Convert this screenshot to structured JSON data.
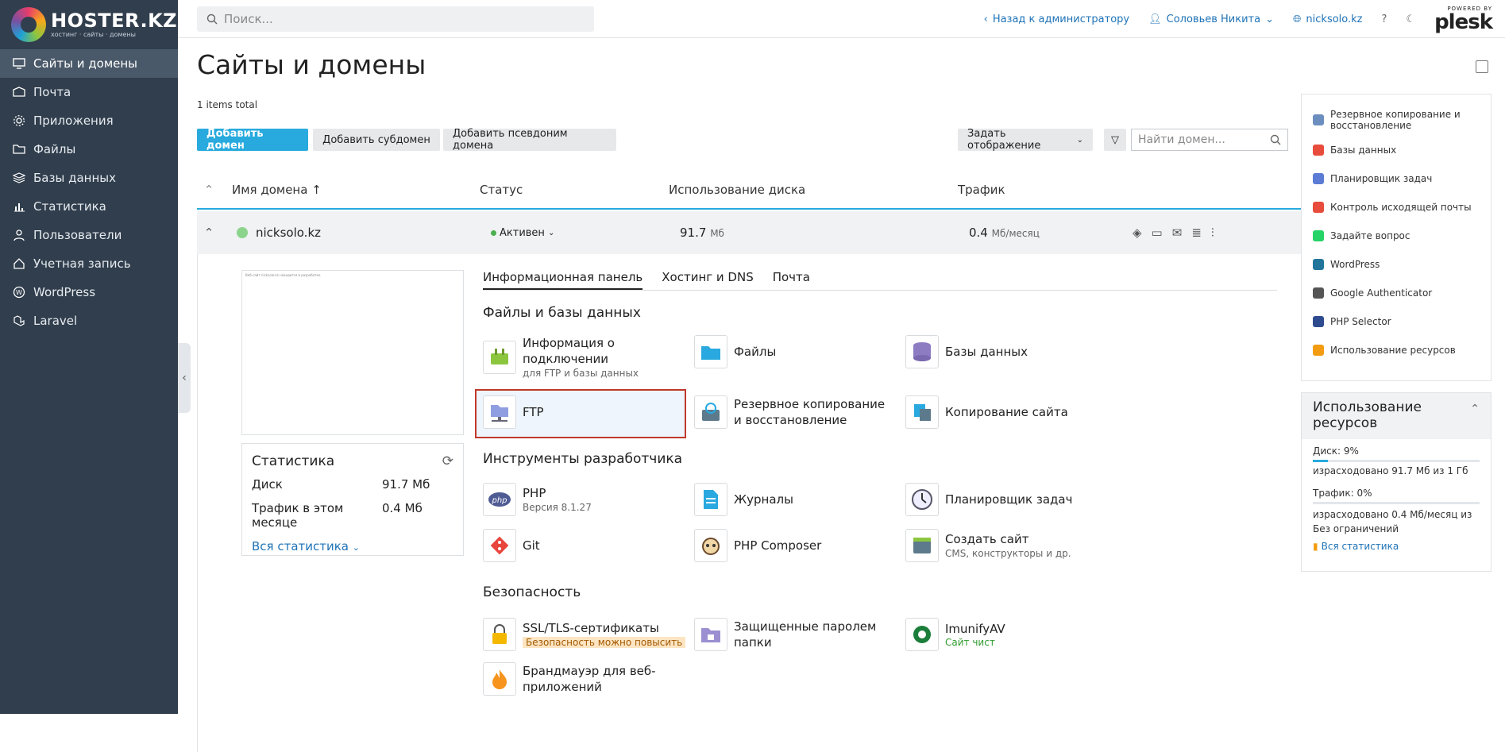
{
  "brand": {
    "name": "HOSTER.KZ",
    "tagline": "хостинг · сайты · домены"
  },
  "sidebar": {
    "items": [
      {
        "label": "Сайты и домены",
        "icon": "monitor-icon",
        "active": true
      },
      {
        "label": "Почта",
        "icon": "mail-icon"
      },
      {
        "label": "Приложения",
        "icon": "gear-icon"
      },
      {
        "label": "Файлы",
        "icon": "folder-icon"
      },
      {
        "label": "Базы данных",
        "icon": "layers-icon"
      },
      {
        "label": "Статистика",
        "icon": "bar-chart-icon"
      },
      {
        "label": "Пользователи",
        "icon": "user-icon"
      },
      {
        "label": "Учетная запись",
        "icon": "account-icon"
      },
      {
        "label": "WordPress",
        "icon": "wordpress-icon"
      },
      {
        "label": "Laravel",
        "icon": "laravel-icon"
      }
    ]
  },
  "topbar": {
    "search_placeholder": "Поиск...",
    "back_admin": "Назад к администратору",
    "user": "Соловьев Никита",
    "domain": "nicksolo.kz",
    "powered_by": "POWERED BY",
    "plesk": "plesk"
  },
  "page": {
    "title": "Сайты и домены",
    "items_total": "1 items total",
    "add_domain": "Добавить домен",
    "add_subdomain": "Добавить субдомен",
    "add_alias": "Добавить псевдоним домена",
    "set_view": "Задать отображение",
    "find_placeholder": "Найти домен..."
  },
  "table": {
    "columns": [
      "Имя домена ↑",
      "Статус",
      "Использование диска",
      "Трафик"
    ],
    "row": {
      "domain": "nicksolo.kz",
      "status": "Активен",
      "disk": "91.7",
      "disk_unit": "Мб",
      "traffic": "0.4",
      "traffic_unit": "Мб/месяц"
    }
  },
  "detail": {
    "thumb_text": "Веб-сайт nicksolo.kz находится в разработке",
    "stats": {
      "title": "Статистика",
      "disk_label": "Диск",
      "disk_value": "91.7 Мб",
      "traffic_label": "Трафик в этом месяце",
      "traffic_value": "0.4 Мб",
      "all_link": "Вся статистика"
    },
    "tabs": [
      "Информационная панель",
      "Хостинг и DNS",
      "Почта"
    ],
    "sections": {
      "files": "Файлы и базы данных",
      "dev": "Инструменты разработчика",
      "security": "Безопасность"
    },
    "tools": {
      "connection": {
        "label": "Информация о подключении",
        "sub": "для FTP и базы данных"
      },
      "files": {
        "label": "Файлы"
      },
      "databases": {
        "label": "Базы данных"
      },
      "ftp": {
        "label": "FTP"
      },
      "backup": {
        "label": "Резервное копирование и восстановление"
      },
      "copy_site": {
        "label": "Копирование сайта"
      },
      "php": {
        "label": "PHP",
        "sub": "Версия 8.1.27"
      },
      "logs": {
        "label": "Журналы"
      },
      "scheduler": {
        "label": "Планировщик задач"
      },
      "git": {
        "label": "Git"
      },
      "composer": {
        "label": "PHP Composer"
      },
      "create_site": {
        "label": "Создать сайт",
        "sub": "CMS, конструкторы и др."
      },
      "ssl": {
        "label": "SSL/TLS-сертификаты",
        "warn": "Безопасность можно повысить"
      },
      "protected": {
        "label": "Защищенные паролем папки"
      },
      "imunify": {
        "label": "ImunifyAV",
        "ok": "Сайт чист"
      },
      "waf": {
        "label": "Брандмауэр для веб-приложений"
      }
    }
  },
  "right_panel": {
    "items": [
      {
        "label": "Резервное копирование и восстановление",
        "color": "#6c8ebf"
      },
      {
        "label": "Базы данных",
        "color": "#e74c3c"
      },
      {
        "label": "Планировщик задач",
        "color": "#5b7bd5"
      },
      {
        "label": "Контроль исходящей почты",
        "color": "#e74c3c"
      },
      {
        "label": "Задайте вопрос",
        "color": "#25d366"
      },
      {
        "label": "WordPress",
        "color": "#21759b"
      },
      {
        "label": "Google Authenticator",
        "color": "#555"
      },
      {
        "label": "PHP Selector",
        "color": "#2e4b8f"
      },
      {
        "label": "Использование ресурсов",
        "color": "#f39c12"
      }
    ],
    "resources": {
      "title": "Использование ресурсов",
      "disk": "Диск: 9%",
      "disk_percent": 9,
      "disk_detail": "израсходовано 91.7 Мб из 1 Гб",
      "traffic": "Трафик: 0%",
      "traffic_detail": "израсходовано 0.4 Мб/месяц из Без ограничений",
      "all_stats": "Вся статистика"
    }
  }
}
